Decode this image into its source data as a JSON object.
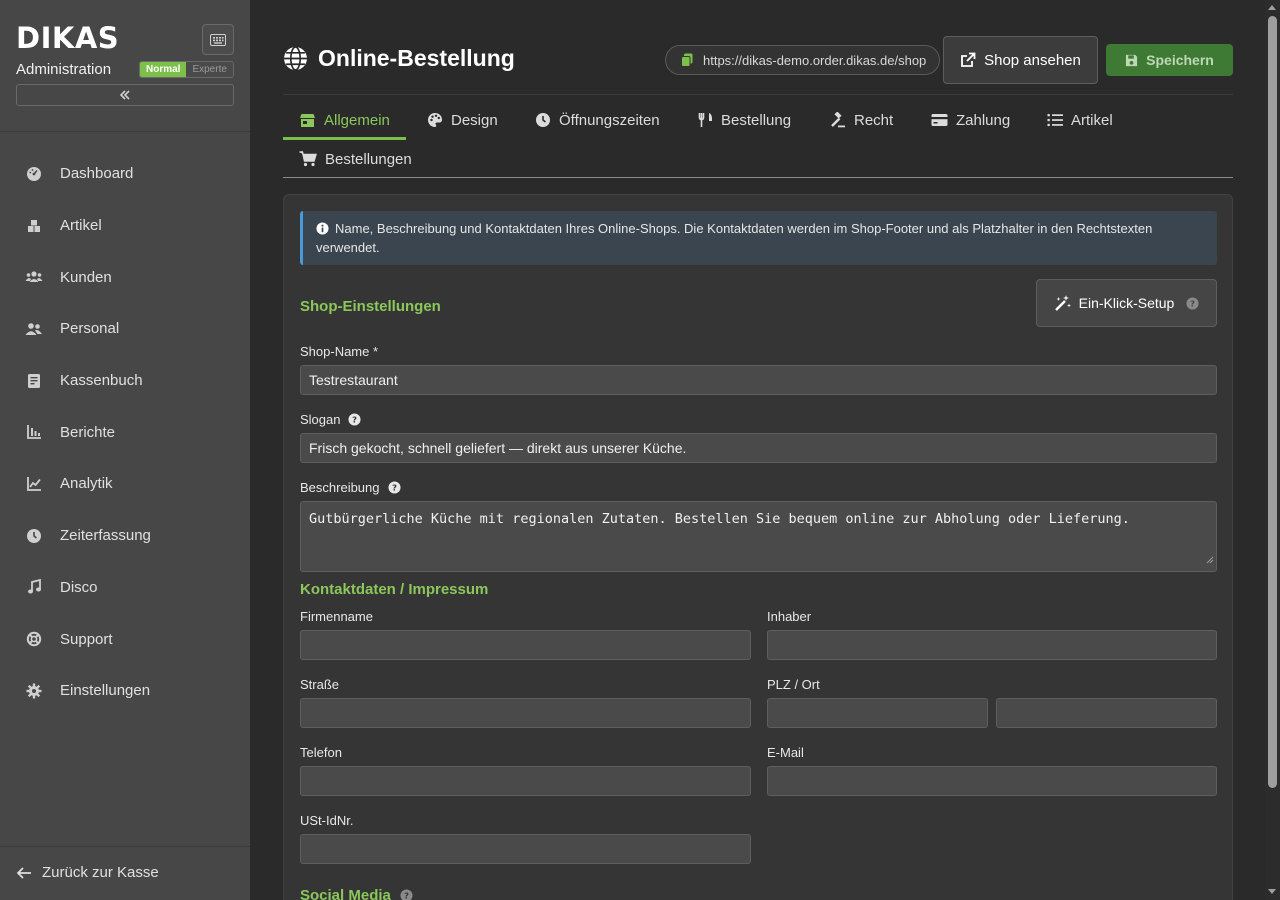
{
  "sidebar": {
    "logo": "DIKAS",
    "subtitle": "Administration",
    "mode_normal": "Normal",
    "mode_expert": "Experte",
    "collapse_glyph": "«",
    "items": [
      {
        "label": "Dashboard",
        "icon": "gauge-icon"
      },
      {
        "label": "Artikel",
        "icon": "box-icon"
      },
      {
        "label": "Kunden",
        "icon": "users-icon"
      },
      {
        "label": "Personal",
        "icon": "staff-icon"
      },
      {
        "label": "Kassenbuch",
        "icon": "book-icon"
      },
      {
        "label": "Berichte",
        "icon": "bar-chart-icon"
      },
      {
        "label": "Analytik",
        "icon": "line-chart-icon"
      },
      {
        "label": "Zeiterfassung",
        "icon": "clock-icon"
      },
      {
        "label": "Disco",
        "icon": "music-icon"
      },
      {
        "label": "Support",
        "icon": "lifebuoy-icon"
      },
      {
        "label": "Einstellungen",
        "icon": "gear-icon"
      }
    ],
    "back_label": "Zurück zur Kasse"
  },
  "header": {
    "title": "Online-Bestellung",
    "url": "https://dikas-demo.order.dikas.de/shop",
    "view_shop_label": "Shop ansehen",
    "save_label": "Speichern"
  },
  "tabs": [
    {
      "label": "Allgemein",
      "icon": "store-icon",
      "active": true
    },
    {
      "label": "Design",
      "icon": "palette-icon"
    },
    {
      "label": "Öffnungszeiten",
      "icon": "clock-icon"
    },
    {
      "label": "Bestellung",
      "icon": "utensils-icon"
    },
    {
      "label": "Recht",
      "icon": "gavel-icon"
    },
    {
      "label": "Zahlung",
      "icon": "credit-card-icon"
    },
    {
      "label": "Artikel",
      "icon": "list-icon"
    },
    {
      "label": "Bestellungen",
      "icon": "cart-icon"
    }
  ],
  "info_text": "Name, Beschreibung und Kontaktdaten Ihres Online-Shops. Die Kontaktdaten werden im Shop-Footer und als Platzhalter in den Rechtstexten verwendet.",
  "shop_settings": {
    "title": "Shop-Einstellungen",
    "setup_label": "Ein-Klick-Setup",
    "name_label": "Shop-Name *",
    "name_value": "Testrestaurant",
    "slogan_label": "Slogan",
    "slogan_value": "Frisch gekocht, schnell geliefert — direkt aus unserer Küche.",
    "description_label": "Beschreibung",
    "description_value": "Gutbürgerliche Küche mit regionalen Zutaten. Bestellen Sie bequem online zur Abholung oder Lieferung."
  },
  "contact": {
    "title": "Kontaktdaten / Impressum",
    "company_label": "Firmenname",
    "company_value": "",
    "owner_label": "Inhaber",
    "owner_value": "",
    "street_label": "Straße",
    "street_value": "",
    "zip_city_label": "PLZ / Ort",
    "zip_value": "",
    "city_value": "",
    "phone_label": "Telefon",
    "phone_value": "",
    "email_label": "E-Mail",
    "email_value": "",
    "vat_label": "USt-IdNr.",
    "vat_value": ""
  },
  "social": {
    "title": "Social Media"
  },
  "colors": {
    "accent": "#7cc04a",
    "sidebar_bg": "#474747",
    "main_bg": "#2a2a2a",
    "save_bg": "#3f7a35",
    "info_border": "#4a9ad8"
  }
}
